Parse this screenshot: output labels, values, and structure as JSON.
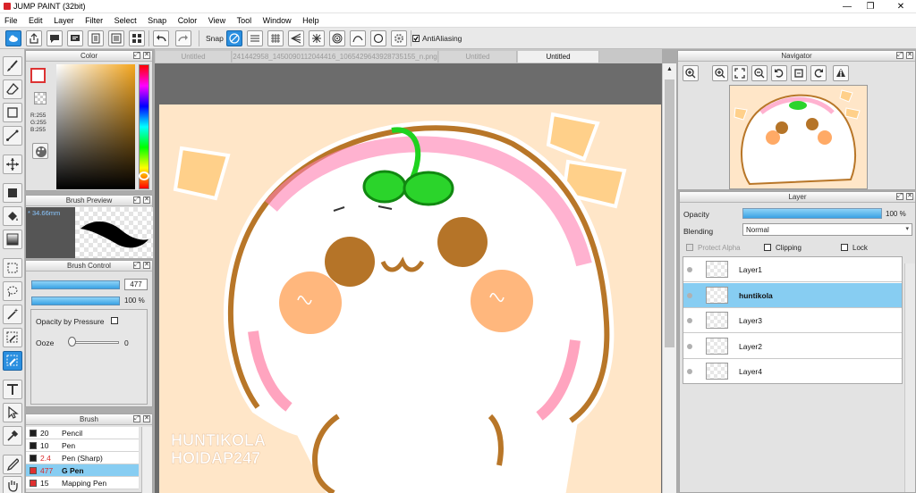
{
  "app": {
    "title": "JUMP PAINT (32bit)"
  },
  "window_controls": {
    "minimize": "—",
    "maximize": "❐",
    "close": "✕"
  },
  "menu": [
    "File",
    "Edit",
    "Layer",
    "Filter",
    "Select",
    "Snap",
    "Color",
    "View",
    "Tool",
    "Window",
    "Help"
  ],
  "toolbar": {
    "snap_label": "Snap",
    "antialiasing_label": "AntiAliasing",
    "antialiasing_checked": true
  },
  "tabs": [
    {
      "label": "Untitled",
      "active": false
    },
    {
      "label": "241442958_1450090112044416_1065429643928735155_n.png",
      "active": false
    },
    {
      "label": "Untitled",
      "active": false
    },
    {
      "label": "Untitled",
      "active": true
    }
  ],
  "color_panel": {
    "title": "Color",
    "r": "R:255",
    "g": "G:255",
    "b": "B:255",
    "primary": "#ffffff"
  },
  "brush_preview": {
    "title": "Brush Preview",
    "size": "* 34.66mm"
  },
  "brush_control": {
    "title": "Brush Control",
    "size_value": "477",
    "opacity_value": "100 %",
    "opacity_by_pressure_label": "Opacity by Pressure",
    "ooze_label": "Ooze",
    "ooze_value": "0"
  },
  "brush_panel": {
    "title": "Brush",
    "items": [
      {
        "size": "20",
        "name": "Pencil",
        "color": "#1e1e1e",
        "selected": false,
        "red": false
      },
      {
        "size": "10",
        "name": "Pen",
        "color": "#1e1e1e",
        "selected": false,
        "red": false
      },
      {
        "size": "2.4",
        "name": "Pen (Sharp)",
        "color": "#1e1e1e",
        "selected": false,
        "red": true
      },
      {
        "size": "477",
        "name": "G Pen",
        "color": "#e03030",
        "selected": true,
        "red": true
      },
      {
        "size": "15",
        "name": "Mapping Pen",
        "color": "#e03030",
        "selected": false,
        "red": false
      }
    ]
  },
  "canvas": {
    "watermark_line1": "HUNTIKOLA",
    "watermark_line2": "HOIDAP247"
  },
  "navigator": {
    "title": "Navigator"
  },
  "layer_panel": {
    "title": "Layer",
    "opacity_label": "Opacity",
    "opacity_value": "100 %",
    "opacity_fraction": 1.0,
    "blending_label": "Blending",
    "blending_value": "Normal",
    "protect_alpha_label": "Protect Alpha",
    "clipping_label": "Clipping",
    "lock_label": "Lock",
    "layers": [
      {
        "name": "Layer1",
        "selected": false
      },
      {
        "name": "huntikola",
        "selected": true
      },
      {
        "name": "Layer3",
        "selected": false
      },
      {
        "name": "Layer2",
        "selected": false
      },
      {
        "name": "Layer4",
        "selected": false
      }
    ]
  }
}
